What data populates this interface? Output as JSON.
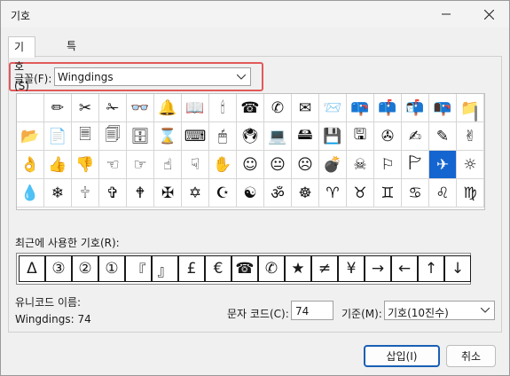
{
  "window": {
    "title": "기호"
  },
  "tabs": [
    {
      "label": "기호(S)",
      "active": true
    },
    {
      "label": "특수 문자(P)",
      "active": false
    }
  ],
  "font": {
    "label": "글꼴(F):",
    "value": "Wingdings"
  },
  "symbol_grid": {
    "selected_index": 49,
    "rows": [
      [
        "",
        "✏",
        "✂",
        "✁",
        "👓",
        "🔔",
        "📖",
        "🕯",
        "☎",
        "✆",
        "✉",
        "📨",
        "📪",
        "📫",
        "📬",
        "📭",
        "📁"
      ],
      [
        "📂",
        "📄",
        "🗏",
        "🗐",
        "🗄",
        "⌛",
        "⌨",
        "🖱",
        "🖲",
        "💻",
        "🖴",
        "💾",
        "🖫",
        "✇",
        "✍",
        "✎",
        "✌"
      ],
      [
        "👌",
        "👍",
        "👎",
        "☜",
        "☞",
        "☝",
        "☟",
        "✋",
        "☺",
        "😐",
        "☹",
        "💣",
        "☠",
        "⚐",
        "🏱",
        "✈",
        "☼"
      ],
      [
        "💧",
        "❄",
        "🕆",
        "✞",
        "🕈",
        "✠",
        "✡",
        "☪",
        "☯",
        "ॐ",
        "☸",
        "♈",
        "♉",
        "♊",
        "♋",
        "♌",
        "♍"
      ]
    ]
  },
  "recent": {
    "label": "최근에 사용한 기호(R):",
    "symbols": [
      "Δ",
      "③",
      "②",
      "①",
      "『",
      "』",
      "£",
      "€",
      "☎",
      "✆",
      "★",
      "≠",
      "¥",
      "→",
      "←",
      "↑",
      "↓"
    ]
  },
  "unicode_name": {
    "label": "유니코드 이름:",
    "value": "Wingdings: 74"
  },
  "char_code": {
    "label": "문자 코드(C):",
    "value": "74"
  },
  "base": {
    "label": "기준(M):",
    "value": "기호(10진수)"
  },
  "buttons": {
    "insert": "삽입(I)",
    "cancel": "취소"
  }
}
